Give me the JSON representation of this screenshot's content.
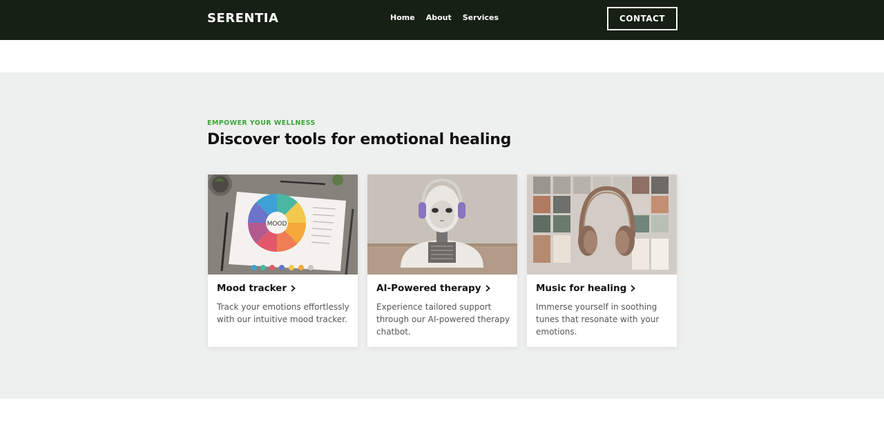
{
  "nav": {
    "brand": "SERENTIA",
    "links": [
      "Home",
      "About",
      "Services"
    ],
    "contact_label": "CONTACT"
  },
  "section": {
    "eyebrow": "EMPOWER YOUR WELLNESS",
    "heading": "Discover tools for emotional healing"
  },
  "cards": [
    {
      "title": "Mood tracker",
      "description": "Track your emotions effortlessly with our intuitive mood tracker.",
      "image_text": "MOOD"
    },
    {
      "title": "AI-Powered therapy",
      "description": "Experience tailored support through our AI-powered therapy chatbot."
    },
    {
      "title": "Music for healing",
      "description": "Immerse yourself in soothing tunes that resonate with your emotions."
    }
  ],
  "colors": {
    "nav_bg": "#172014",
    "section_bg": "#eef0ef",
    "accent_green": "#3fa33a"
  }
}
